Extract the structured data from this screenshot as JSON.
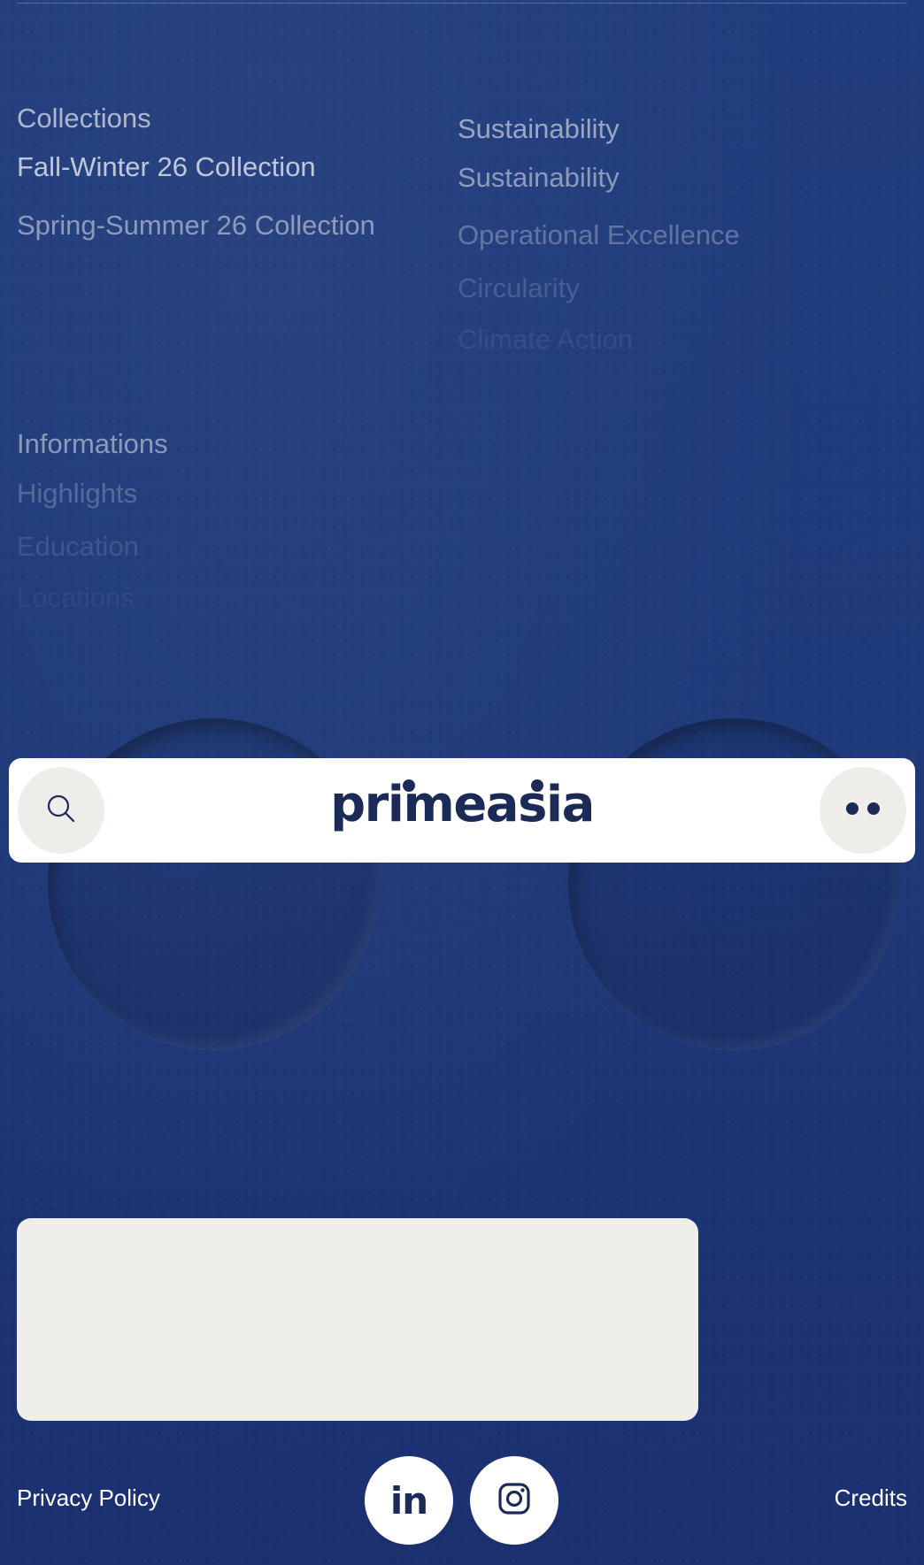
{
  "collections": {
    "title": "Collections",
    "links": [
      "Fall-Winter 26 Collection",
      "Spring-Summer 26 Collection"
    ]
  },
  "sustainability": {
    "title": "Sustainability",
    "links": [
      "Sustainability",
      "Operational Excellence",
      "Circularity",
      "Climate Action"
    ]
  },
  "informations": {
    "title": "Informations",
    "links": [
      "Highlights",
      "Education",
      "Locations"
    ]
  },
  "navbar": {
    "logo": "primeasia",
    "search_icon": "search-icon",
    "menu_icon": "menu-dots-icon"
  },
  "footer": {
    "privacy_label": "Privacy Policy",
    "credits_label": "Credits",
    "social": [
      {
        "icon": "linkedin-icon",
        "label": "in"
      },
      {
        "icon": "instagram-icon"
      }
    ]
  },
  "colors": {
    "background": "#1f3a7a",
    "brand": "#1c2a58",
    "card": "#efeeeb",
    "nav_button": "#eeede9"
  }
}
